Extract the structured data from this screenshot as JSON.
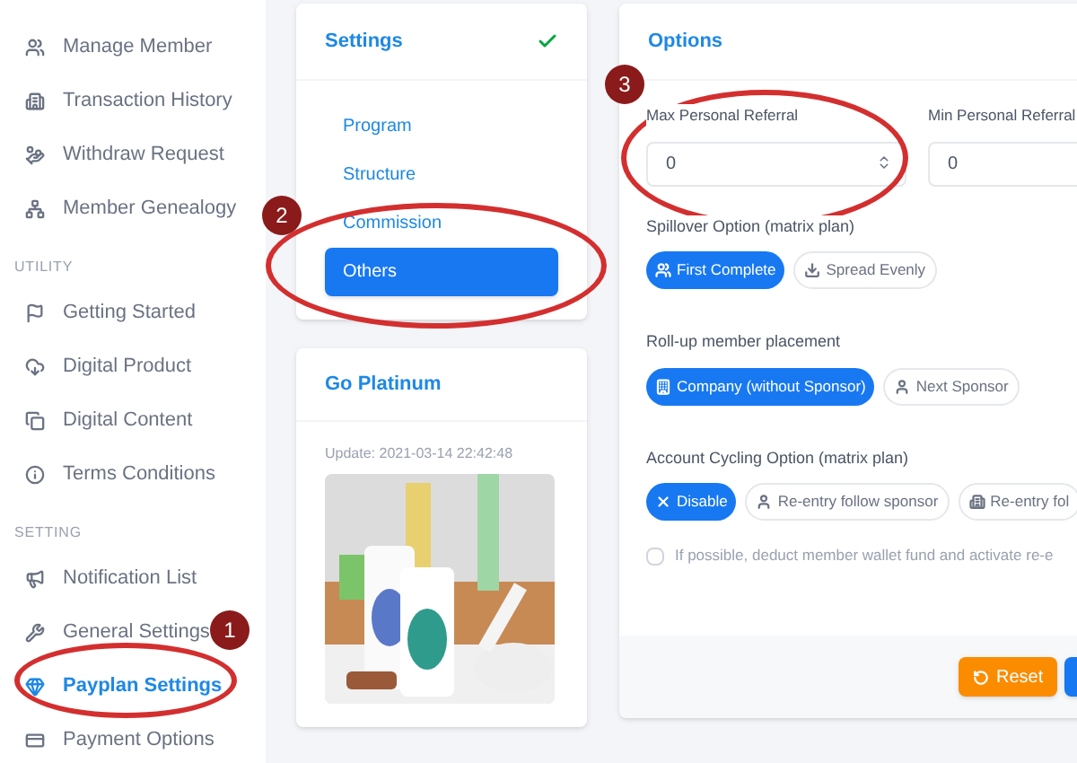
{
  "sidebar": {
    "sections": [
      {
        "items": [
          {
            "label": "Manage Member",
            "selected": false
          },
          {
            "label": "Transaction History",
            "selected": false
          },
          {
            "label": "Withdraw Request",
            "selected": false
          },
          {
            "label": "Member Genealogy",
            "selected": false
          }
        ]
      },
      {
        "header": "UTILITY",
        "items": [
          {
            "label": "Getting Started",
            "selected": false
          },
          {
            "label": "Digital Product",
            "selected": false
          },
          {
            "label": "Digital Content",
            "selected": false
          },
          {
            "label": "Terms Conditions",
            "selected": false
          }
        ]
      },
      {
        "header": "SETTING",
        "items": [
          {
            "label": "Notification List",
            "selected": false
          },
          {
            "label": "General Settings",
            "selected": false
          },
          {
            "label": "Payplan Settings",
            "selected": true
          },
          {
            "label": "Payment Options",
            "selected": false
          }
        ]
      }
    ]
  },
  "settings_card": {
    "title": "Settings",
    "complete": true,
    "items": [
      {
        "label": "Program",
        "selected": false
      },
      {
        "label": "Structure",
        "selected": false
      },
      {
        "label": "Commission",
        "selected": false
      },
      {
        "label": "Others",
        "selected": true
      }
    ]
  },
  "promo_card": {
    "title": "Go Platinum",
    "update": "Update: 2021-03-14 22:42:48"
  },
  "options": {
    "title": "Options",
    "fields": [
      {
        "label": "Max Personal Referral",
        "value": "0",
        "spinner": true
      },
      {
        "label": "Min Personal Referral",
        "value": "0"
      }
    ],
    "groups": [
      {
        "label": "Spillover Option (matrix plan)",
        "options": [
          {
            "label": "First Complete",
            "selected": true
          },
          {
            "label": "Spread Evenly",
            "selected": false
          }
        ]
      },
      {
        "label": "Roll-up member placement",
        "options": [
          {
            "label": "Company (without Sponsor)",
            "selected": true
          },
          {
            "label": "Next Sponsor",
            "selected": false
          }
        ]
      },
      {
        "label": "Account Cycling Option (matrix plan)",
        "options": [
          {
            "label": "Disable",
            "selected": true
          },
          {
            "label": "Re-entry follow sponsor",
            "selected": false
          },
          {
            "label": "Re-entry fol",
            "selected": false
          }
        ]
      }
    ],
    "checkbox": {
      "label": "If possible, deduct member wallet fund and activate re-e",
      "checked": false
    },
    "buttons": [
      {
        "label": "Reset",
        "kind": "warning"
      },
      {
        "kind": "primary"
      }
    ]
  },
  "annotations": [
    {
      "number": "1"
    },
    {
      "number": "2"
    },
    {
      "number": "3"
    }
  ]
}
